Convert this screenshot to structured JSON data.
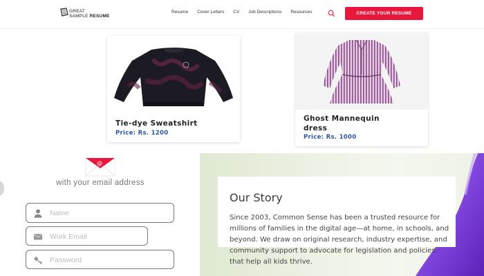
{
  "header": {
    "logo_line1": "GREAT",
    "logo_line2_a": "SAMPLE",
    "logo_line2_b": "RESUME",
    "nav": [
      "Resume",
      "Cover Letters",
      "CV",
      "Job Descriptions",
      "Resources"
    ],
    "search_icon": "search-icon",
    "cta_label": "CREATE YOUR RESUME"
  },
  "products": [
    {
      "name": "Tie-dye Sweatshirt",
      "price": "Price: Rs. 1200"
    },
    {
      "name": "Ghost Mannequin dress",
      "price": "Price: Rs. 1000"
    }
  ],
  "signup": {
    "subheading": "with your email address",
    "name_placeholder": "Name",
    "email_placeholder": "Work Email",
    "password_placeholder": "Password"
  },
  "story": {
    "title": "Our Story",
    "body": "Since 2003, Common Sense has been a trusted resource for millions of families in the digital age—at home, in schools, and beyond. We draw on original research, industry expertise, and community support to advocate for legislation and policies that help all kids thrive."
  },
  "colors": {
    "accent": "#e8173c",
    "price": "#2d56a8",
    "story_bg": "#e6eedc",
    "purple": "#7b3fd6"
  }
}
